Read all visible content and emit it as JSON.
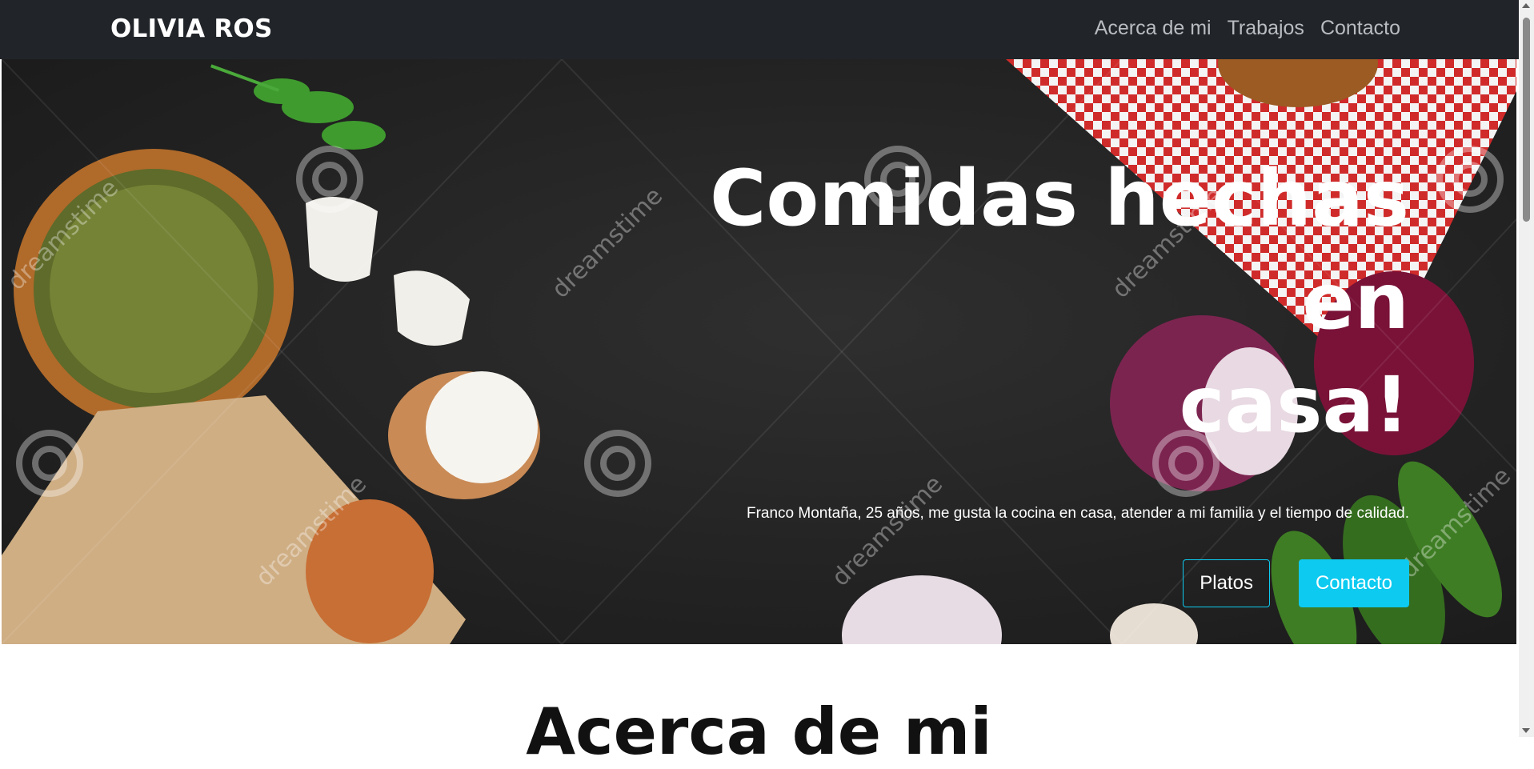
{
  "navbar": {
    "brand": "OLIVIA ROS",
    "links": [
      "Acerca de mi",
      "Trabajos",
      "Contacto"
    ]
  },
  "hero": {
    "title_line1": "Comidas hechas en",
    "title_line2": "casa!",
    "subtitle": "Franco Montaña, 25 años, me gusta la cocina en casa, atender a mi familia y el tiempo de calidad.",
    "buttons": {
      "primary_outline": "Platos",
      "primary_solid": "Contacto"
    },
    "background_image": "food-flatlay-background",
    "watermark": "dreamstime"
  },
  "about": {
    "title": "Acerca de mi"
  },
  "colors": {
    "navbar": "#212529",
    "accent": "#0dcaf0",
    "nav_link": "#b9bcc0"
  }
}
